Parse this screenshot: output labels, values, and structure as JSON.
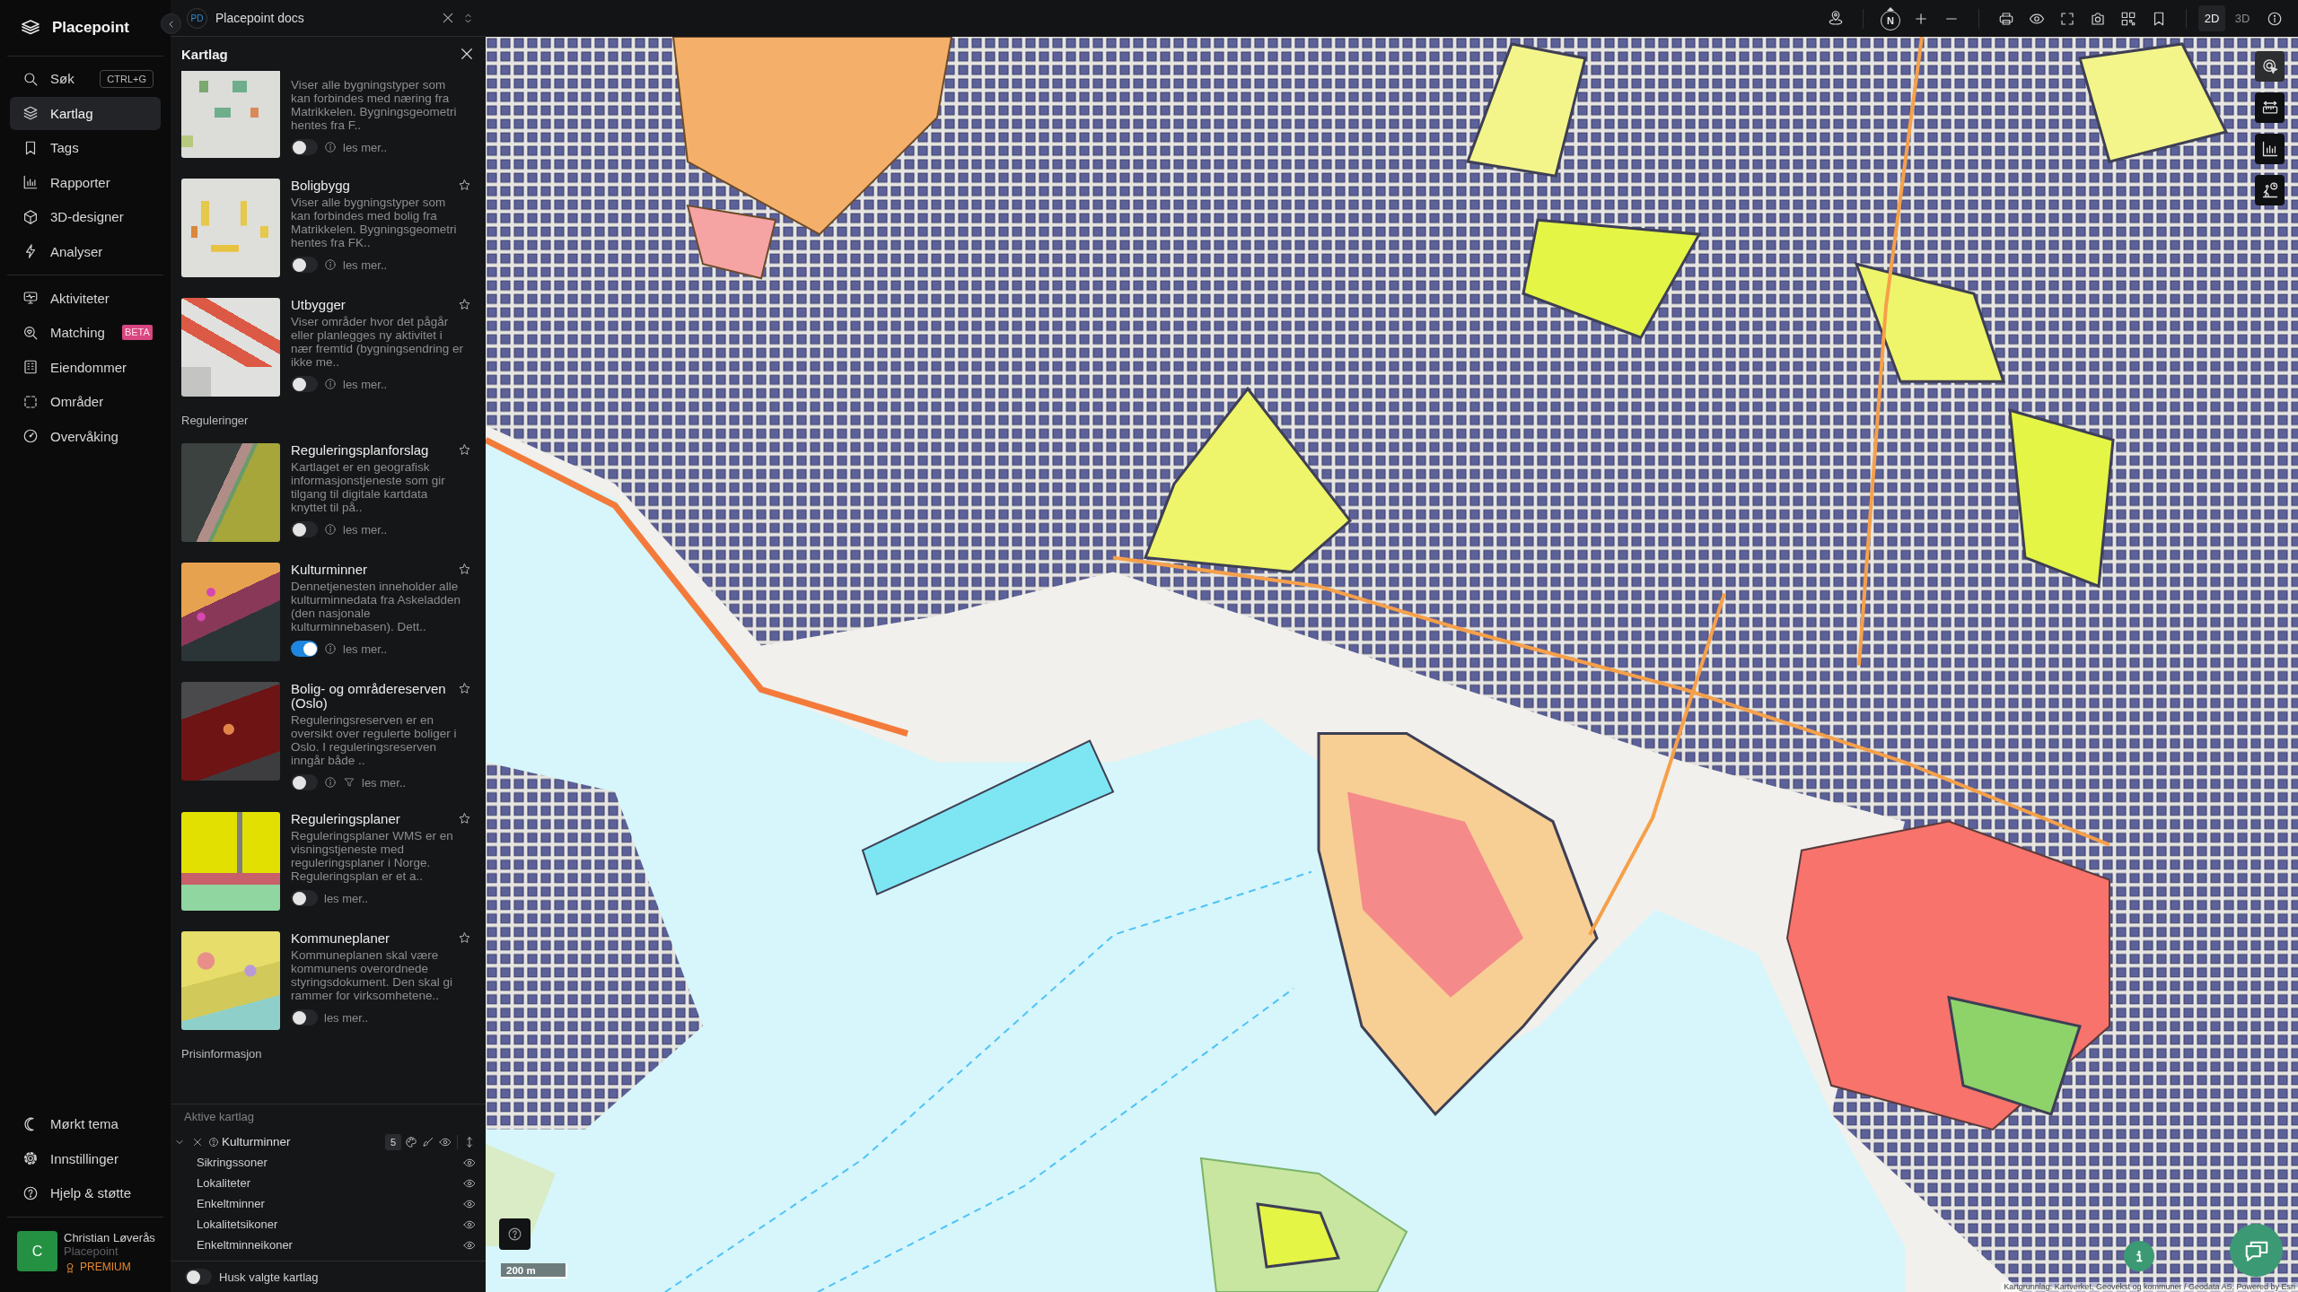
{
  "sidebar": {
    "logo": "Placepoint",
    "main_items": [
      {
        "label": "Søk",
        "shortcut": "CTRL+G",
        "selected": false
      },
      {
        "label": "Kartlag",
        "selected": true
      },
      {
        "label": "Tags",
        "selected": false
      },
      {
        "label": "Rapporter",
        "selected": false
      },
      {
        "label": "3D-designer",
        "selected": false
      },
      {
        "label": "Analyser",
        "selected": false
      }
    ],
    "work_items": [
      {
        "label": "Aktiviteter",
        "selected": false
      },
      {
        "label": "Matching",
        "badge": "BETA",
        "selected": false
      },
      {
        "label": "Eiendommer",
        "selected": false
      },
      {
        "label": "Områder",
        "selected": false
      },
      {
        "label": "Overvåking",
        "selected": false
      }
    ],
    "bottom_items": [
      {
        "label": "Mørkt tema"
      },
      {
        "label": "Innstillinger"
      },
      {
        "label": "Hjelp & støtte"
      }
    ],
    "user": {
      "initial": "C",
      "name": "Christian Løverås",
      "organization": "Placepoint",
      "plan": "PREMIUM"
    }
  },
  "tab": {
    "avatar": "PD",
    "title": "Placepoint docs"
  },
  "map_toolbar": {
    "compass": "N",
    "view_modes": [
      {
        "label": "2D",
        "selected": true
      },
      {
        "label": "3D",
        "selected": false
      }
    ]
  },
  "layers_panel": {
    "title": "Kartlag",
    "items": [
      {
        "kind": "layer",
        "description": "Viser alle bygningstyper som kan forbindes med næring fra Matrikkelen. Bygningsgeometri hentes fra F..",
        "on": false,
        "actions": [
          {
            "kind": "info"
          }
        ],
        "more": "les mer.."
      },
      {
        "kind": "layer",
        "title": "Boligbygg",
        "starred": false,
        "description": "Viser alle bygningstyper som kan forbindes med bolig fra Matrikkelen. Bygningsgeometri hentes fra FK..",
        "on": false,
        "actions": [
          {
            "kind": "info"
          }
        ],
        "more": "les mer.."
      },
      {
        "kind": "layer",
        "title": "Utbygger",
        "starred": false,
        "description": "Viser områder hvor det pågår eller planlegges ny aktivitet i nær fremtid (bygningsendring er ikke me..",
        "on": false,
        "actions": [
          {
            "kind": "info"
          }
        ],
        "more": "les mer.."
      },
      {
        "kind": "heading",
        "label": "Reguleringer"
      },
      {
        "kind": "layer",
        "title": "Reguleringsplanforslag",
        "starred": false,
        "description": "Kartlaget er en geografisk informasjonstjeneste som gir tilgang til digitale kartdata knyttet til på..",
        "on": false,
        "actions": [
          {
            "kind": "info"
          }
        ],
        "more": "les mer.."
      },
      {
        "kind": "layer",
        "title": "Kulturminner",
        "starred": false,
        "description": "Dennetjenesten inneholder alle kulturminnedata fra Askeladden (den nasjonale kulturminnebasen). Dett..",
        "on": true,
        "actions": [
          {
            "kind": "info"
          }
        ],
        "more": "les mer.."
      },
      {
        "kind": "layer",
        "title": "Bolig- og områdereserven (Oslo)",
        "starred": false,
        "description": "Reguleringsreserven er en oversikt over regulerte boliger i Oslo. I reguleringsreserven inngår både ..",
        "on": false,
        "actions": [
          {
            "kind": "info"
          },
          {
            "kind": "filter"
          }
        ],
        "more": "les mer.."
      },
      {
        "kind": "layer",
        "title": "Reguleringsplaner",
        "starred": false,
        "description": "Reguleringsplaner WMS er en visningstjeneste med reguleringsplaner i Norge. Reguleringsplan er et a..",
        "on": false,
        "more": "les mer.."
      },
      {
        "kind": "layer",
        "title": "Kommuneplaner",
        "starred": false,
        "description": "Kommuneplanen skal være kommunens overordnede styringsdokument. Den skal gi rammer for virksomhetene..",
        "on": false,
        "more": "les mer.."
      },
      {
        "kind": "heading",
        "label": "Prisinformasjon"
      }
    ],
    "active": {
      "heading": "Aktive kartlag",
      "layers": [
        {
          "name": "Kulturminner",
          "expanded": true,
          "count": "5",
          "sublayers": [
            {
              "name": "Sikringssoner",
              "visible": true
            },
            {
              "name": "Lokaliteter",
              "visible": true
            },
            {
              "name": "Enkeltminner",
              "visible": true
            },
            {
              "name": "Lokalitetsikoner",
              "visible": true
            },
            {
              "name": "Enkeltminneikoner",
              "visible": true
            }
          ]
        }
      ]
    },
    "remember": {
      "label": "Husk valgte kartlag",
      "on": false
    }
  },
  "map": {
    "tools": [
      {
        "selected": true
      },
      {
        "selected": false
      },
      {
        "selected": false
      },
      {
        "selected": false
      }
    ],
    "scale": "200 m",
    "attribution": "Kartgrunnlag: Kartverket, Geovekst og kommuner / Geodata AS, Powered by Esri"
  }
}
